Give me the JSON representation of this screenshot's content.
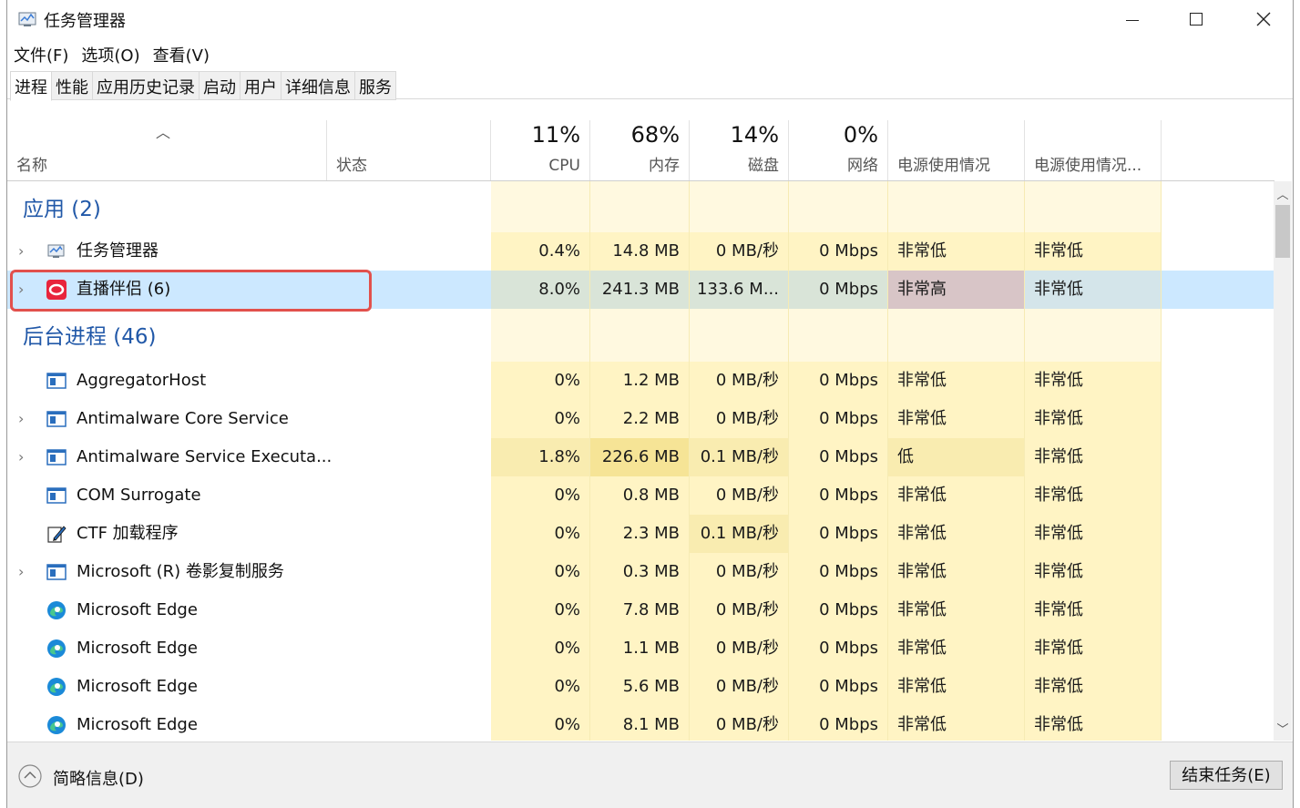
{
  "window": {
    "title": "任务管理器"
  },
  "menu": [
    "文件(F)",
    "选项(O)",
    "查看(V)"
  ],
  "tabs": [
    "进程",
    "性能",
    "应用历史记录",
    "启动",
    "用户",
    "详细信息",
    "服务"
  ],
  "columns": {
    "name": "名称",
    "status": "状态",
    "cpu": {
      "pct": "11%",
      "label": "CPU"
    },
    "memory": {
      "pct": "68%",
      "label": "内存"
    },
    "disk": {
      "pct": "14%",
      "label": "磁盘"
    },
    "network": {
      "pct": "0%",
      "label": "网络"
    },
    "power": "电源使用情况",
    "power_trend": "电源使用情况..."
  },
  "groups": {
    "apps": "应用 (2)",
    "background": "后台进程 (46)"
  },
  "apps": [
    {
      "name": "任务管理器",
      "cpu": "0.4%",
      "mem": "14.8 MB",
      "disk": "0 MB/秒",
      "net": "0 Mbps",
      "power": "非常低",
      "power_trend": "非常低"
    },
    {
      "name": "直播伴侣 (6)",
      "cpu": "8.0%",
      "mem": "241.3 MB",
      "disk": "133.6 M...",
      "net": "0 Mbps",
      "power": "非常高",
      "power_trend": "非常低"
    }
  ],
  "background": [
    {
      "name": "AggregatorHost",
      "cpu": "0%",
      "mem": "1.2 MB",
      "disk": "0 MB/秒",
      "net": "0 Mbps",
      "power": "非常低",
      "power_trend": "非常低"
    },
    {
      "name": "Antimalware Core Service",
      "cpu": "0%",
      "mem": "2.2 MB",
      "disk": "0 MB/秒",
      "net": "0 Mbps",
      "power": "非常低",
      "power_trend": "非常低"
    },
    {
      "name": "Antimalware Service Executa...",
      "cpu": "1.8%",
      "mem": "226.6 MB",
      "disk": "0.1 MB/秒",
      "net": "0 Mbps",
      "power": "低",
      "power_trend": "非常低"
    },
    {
      "name": "COM Surrogate",
      "cpu": "0%",
      "mem": "0.8 MB",
      "disk": "0 MB/秒",
      "net": "0 Mbps",
      "power": "非常低",
      "power_trend": "非常低"
    },
    {
      "name": "CTF 加载程序",
      "cpu": "0%",
      "mem": "2.3 MB",
      "disk": "0.1 MB/秒",
      "net": "0 Mbps",
      "power": "非常低",
      "power_trend": "非常低"
    },
    {
      "name": "Microsoft (R) 卷影复制服务",
      "cpu": "0%",
      "mem": "0.3 MB",
      "disk": "0 MB/秒",
      "net": "0 Mbps",
      "power": "非常低",
      "power_trend": "非常低"
    },
    {
      "name": "Microsoft Edge",
      "cpu": "0%",
      "mem": "7.8 MB",
      "disk": "0 MB/秒",
      "net": "0 Mbps",
      "power": "非常低",
      "power_trend": "非常低"
    },
    {
      "name": "Microsoft Edge",
      "cpu": "0%",
      "mem": "1.1 MB",
      "disk": "0 MB/秒",
      "net": "0 Mbps",
      "power": "非常低",
      "power_trend": "非常低"
    },
    {
      "name": "Microsoft Edge",
      "cpu": "0%",
      "mem": "5.6 MB",
      "disk": "0 MB/秒",
      "net": "0 Mbps",
      "power": "非常低",
      "power_trend": "非常低"
    },
    {
      "name": "Microsoft Edge",
      "cpu": "0%",
      "mem": "8.1 MB",
      "disk": "0 MB/秒",
      "net": "0 Mbps",
      "power": "非常低",
      "power_trend": "非常低"
    }
  ],
  "footer": {
    "fewer_details": "简略信息(D)",
    "end_task": "结束任务(E)"
  }
}
